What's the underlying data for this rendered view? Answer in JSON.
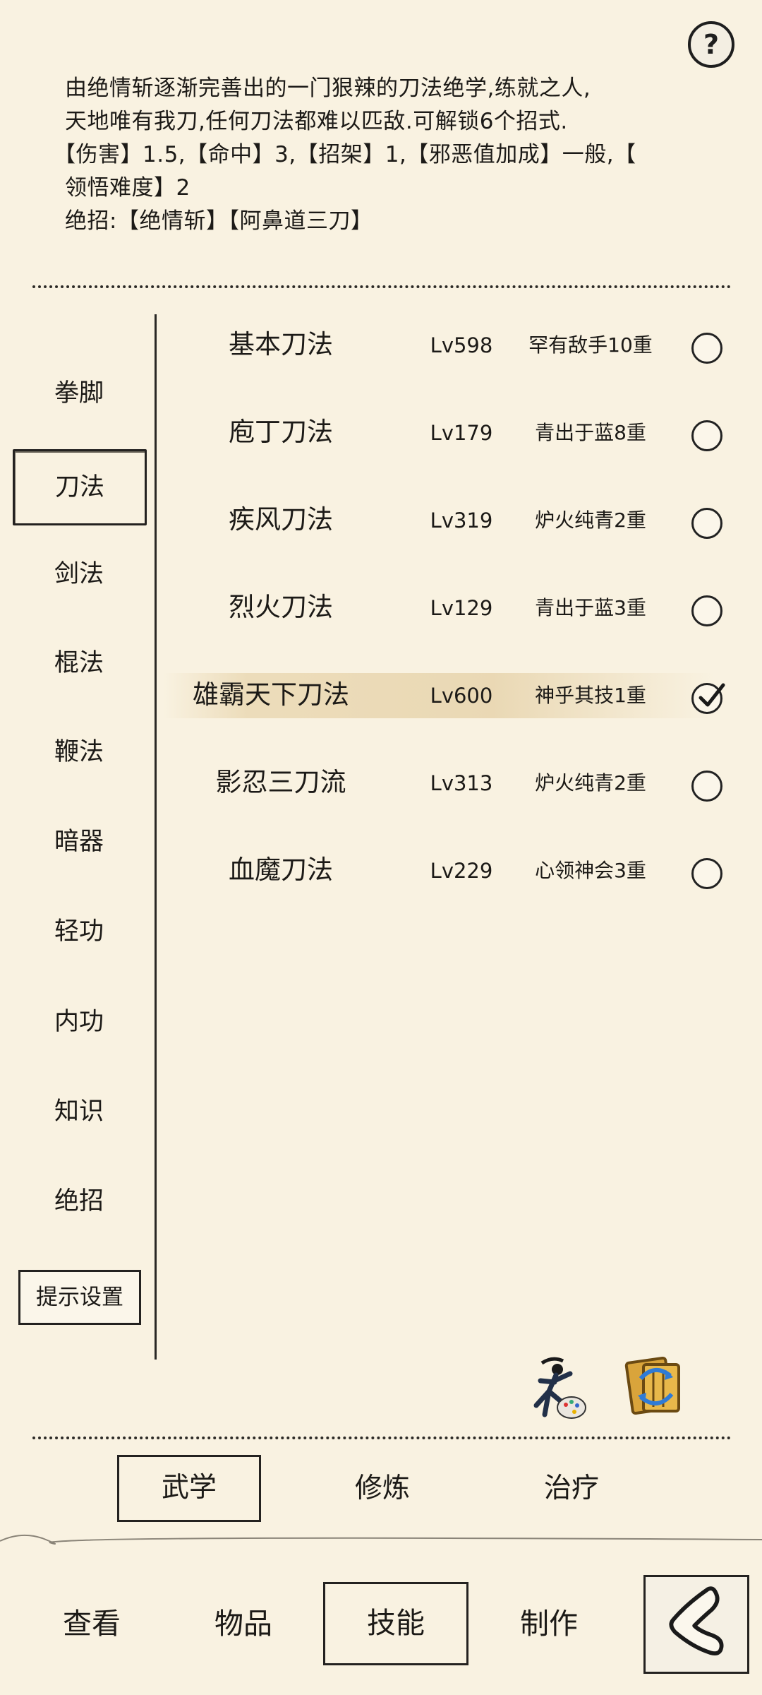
{
  "help": {
    "icon": "help-icon",
    "glyph": "?"
  },
  "description": {
    "line1": "由绝情斩逐渐完善出的一门狠辣的刀法绝学,练就之人,",
    "line2": "天地唯有我刀,任何刀法都难以匹敌.可解锁6个招式.",
    "line3": "【伤害】1.5,【命中】3,【招架】1,【邪恶值加成】一般,【",
    "line4": "领悟难度】2",
    "line5": "绝招:【绝情斩】【阿鼻道三刀】"
  },
  "categories": [
    {
      "label": "拳脚"
    },
    {
      "label": "刀法"
    },
    {
      "label": "剑法"
    },
    {
      "label": "棍法"
    },
    {
      "label": "鞭法"
    },
    {
      "label": "暗器"
    },
    {
      "label": "轻功"
    },
    {
      "label": "内功"
    },
    {
      "label": "知识"
    },
    {
      "label": "绝招"
    }
  ],
  "settings_button": "提示设置",
  "skills": [
    {
      "name": "基本刀法",
      "level": "Lv598",
      "realm": "罕有敌手10重",
      "selected": false
    },
    {
      "name": "庖丁刀法",
      "level": "Lv179",
      "realm": "青出于蓝8重",
      "selected": false
    },
    {
      "name": "疾风刀法",
      "level": "Lv319",
      "realm": "炉火纯青2重",
      "selected": false
    },
    {
      "name": "烈火刀法",
      "level": "Lv129",
      "realm": "青出于蓝3重",
      "selected": false
    },
    {
      "name": "雄霸天下刀法",
      "level": "Lv600",
      "realm": "神乎其技1重",
      "selected": true
    },
    {
      "name": "影忍三刀流",
      "level": "Lv313",
      "realm": "炉火纯青2重",
      "selected": false
    },
    {
      "name": "血魔刀法",
      "level": "Lv229",
      "realm": "心领神会3重",
      "selected": false
    }
  ],
  "action_icons": [
    "martial-artist-palette-icon",
    "scroll-swap-icon"
  ],
  "sub_tabs": [
    {
      "label": "武学"
    },
    {
      "label": "修炼"
    },
    {
      "label": "治疗"
    }
  ],
  "bottom_nav": [
    {
      "label": "查看"
    },
    {
      "label": "物品"
    },
    {
      "label": "技能"
    },
    {
      "label": "制作"
    }
  ],
  "back_icon": "back-arrow-icon",
  "colors": {
    "background": "#f9f2e1",
    "ink": "#1c1a17",
    "highlight": "#e9d7b2"
  }
}
